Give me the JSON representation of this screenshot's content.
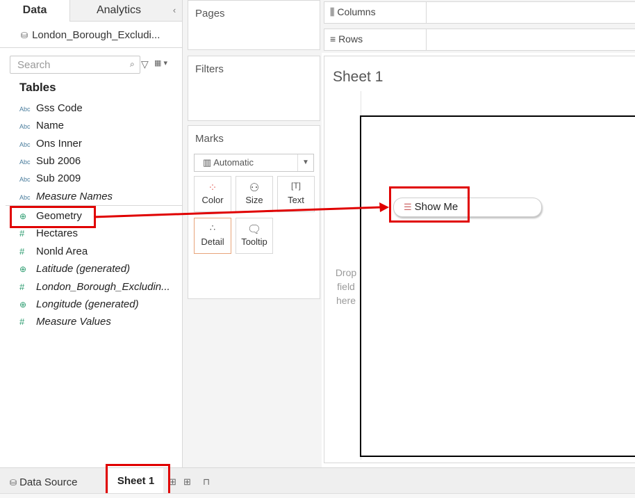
{
  "data_pane": {
    "tab_data": "Data",
    "tab_analytics": "Analytics",
    "collapse_glyph": "‹",
    "datasource_name": "London_Borough_Excludi...",
    "search_placeholder": "Search",
    "tables_heading": "Tables",
    "fields": [
      {
        "label": "Gss Code",
        "type": "Abc",
        "italic": false
      },
      {
        "label": "Name",
        "type": "Abc",
        "italic": false
      },
      {
        "label": "Ons Inner",
        "type": "Abc",
        "italic": false
      },
      {
        "label": "Sub 2006",
        "type": "Abc",
        "italic": false
      },
      {
        "label": "Sub 2009",
        "type": "Abc",
        "italic": false
      },
      {
        "label": "Measure Names",
        "type": "Abc",
        "italic": true
      },
      {
        "label": "Geometry",
        "type": "geo",
        "italic": false
      },
      {
        "label": "Hectares",
        "type": "#",
        "italic": false
      },
      {
        "label": "Nonld Area",
        "type": "#",
        "italic": false
      },
      {
        "label": "Latitude (generated)",
        "type": "geo",
        "italic": true
      },
      {
        "label": "London_Borough_Excludin...",
        "type": "#",
        "italic": true
      },
      {
        "label": "Longitude (generated)",
        "type": "geo",
        "italic": true
      },
      {
        "label": "Measure Values",
        "type": "#",
        "italic": true
      }
    ]
  },
  "cards": {
    "pages": "Pages",
    "filters": "Filters",
    "marks": "Marks",
    "mark_type": "Automatic",
    "mark_buttons": [
      {
        "label": "Color",
        "icon": "color-icon"
      },
      {
        "label": "Size",
        "icon": "size-icon"
      },
      {
        "label": "Text",
        "icon": "text-icon"
      },
      {
        "label": "Detail",
        "icon": "detail-icon"
      },
      {
        "label": "Tooltip",
        "icon": "tooltip-icon"
      }
    ]
  },
  "shelves": {
    "columns": "Columns",
    "rows": "Rows"
  },
  "canvas": {
    "sheet_title": "Sheet 1",
    "drop_field_text": "Drop field here",
    "show_me_label": "Show Me"
  },
  "tab_bar": {
    "datasource_tab": "Data Source",
    "sheet_tab": "Sheet 1"
  },
  "colors": {
    "highlight": "#e00000",
    "arrow": "#e00000",
    "field_dimension": "#4a7d9d",
    "field_measure": "#2a9b6e"
  }
}
